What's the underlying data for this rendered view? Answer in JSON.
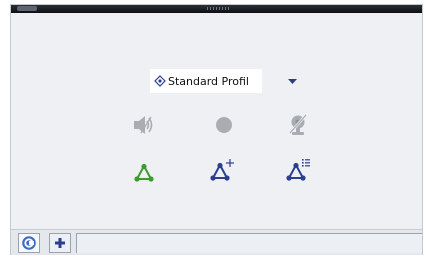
{
  "profile": {
    "label": "Standard Profil"
  },
  "controls": {
    "row1": [
      {
        "name": "speaker-mute",
        "icon": "speaker-muted-icon",
        "state": "disabled"
      },
      {
        "name": "record",
        "icon": "record-dot-icon",
        "state": "disabled"
      },
      {
        "name": "webcam",
        "icon": "webcam-off-icon",
        "state": "disabled"
      }
    ],
    "row2": [
      {
        "name": "network",
        "icon": "network-green-icon"
      },
      {
        "name": "network-add",
        "icon": "network-add-icon"
      },
      {
        "name": "network-list",
        "icon": "network-list-icon"
      }
    ]
  },
  "tabs": [
    {
      "name": "home-tab",
      "icon": "circle-c-icon",
      "active": true
    },
    {
      "name": "add-tab",
      "icon": "plus-icon",
      "active": false
    }
  ],
  "colors": {
    "disabled": "#a9adb2",
    "green": "#3e9a2e",
    "blue": "#2a3f90",
    "tabIconBlue": "#3d6cc3"
  }
}
